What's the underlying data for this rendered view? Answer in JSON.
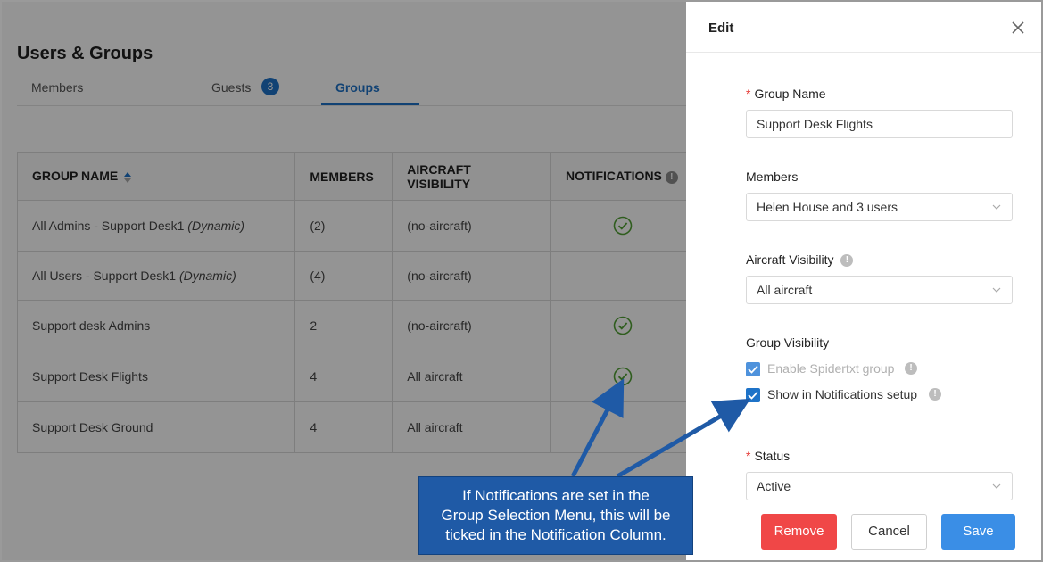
{
  "page": {
    "title": "Users & Groups"
  },
  "tabs": [
    {
      "label": "Members"
    },
    {
      "label": "Guests",
      "badge": "3"
    },
    {
      "label": "Groups",
      "active": true
    }
  ],
  "table": {
    "headers": [
      "GROUP NAME",
      "MEMBERS",
      "AIRCRAFT VISIBILITY",
      "NOTIFICATIONS"
    ],
    "rows": [
      {
        "name": "All Admins - Support Desk1",
        "tag": "(Dynamic)",
        "members": "(2)",
        "aircraft": "(no-aircraft)",
        "notified": true
      },
      {
        "name": "All Users - Support Desk1",
        "tag": "(Dynamic)",
        "members": "(4)",
        "aircraft": "(no-aircraft)",
        "notified": false
      },
      {
        "name": "Support desk Admins",
        "tag": "",
        "members": "2",
        "aircraft": "(no-aircraft)",
        "notified": true
      },
      {
        "name": "Support Desk Flights",
        "tag": "",
        "members": "4",
        "aircraft": "All aircraft",
        "notified": true
      },
      {
        "name": "Support Desk Ground",
        "tag": "",
        "members": "4",
        "aircraft": "All aircraft",
        "notified": false
      }
    ]
  },
  "drawer": {
    "title": "Edit",
    "group_name_label": "Group Name",
    "group_name_value": "Support Desk Flights",
    "members_label": "Members",
    "members_value": "Helen House and 3 users",
    "aircraft_label": "Aircraft Visibility",
    "aircraft_value": "All aircraft",
    "group_visibility_label": "Group Visibility",
    "enable_spidertxt_label": "Enable Spidertxt group",
    "show_notifications_label": "Show in Notifications setup",
    "status_label": "Status",
    "status_value": "Active",
    "remove_label": "Remove",
    "cancel_label": "Cancel",
    "save_label": "Save"
  },
  "callout": {
    "line1": "If Notifications are set in the",
    "line2": "Group Selection Menu, this will be",
    "line3": "ticked in the Notification Column."
  },
  "colors": {
    "accent": "#1e73c8",
    "success": "#52a135",
    "danger": "#f04747",
    "callout": "#1f5aa6"
  }
}
